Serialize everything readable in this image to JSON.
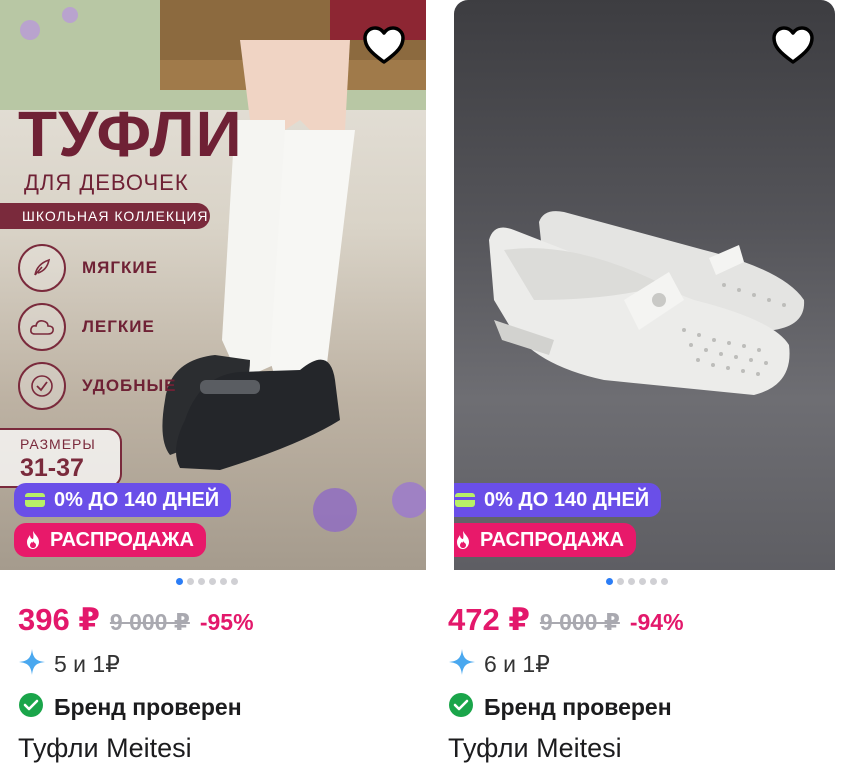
{
  "products": [
    {
      "promo": {
        "title": "ТУФЛИ",
        "subtitle": "ДЛЯ ДЕВОЧЕК",
        "ribbon": "ШКОЛЬНАЯ КОЛЛЕКЦИЯ",
        "features": [
          "МЯГКИЕ",
          "ЛЕГКИЕ",
          "УДОБНЫЕ"
        ],
        "sizes_label": "РАЗМЕРЫ",
        "sizes_value": "31-37"
      },
      "installment_badge": "0% ДО 140 ДНЕЙ",
      "sale_badge": "РАСПРОДАЖА",
      "price": "396 ₽",
      "old_price": "9 000 ₽",
      "discount": "-95%",
      "points": "5 и 1₽",
      "brand_check": "Бренд проверен",
      "title": "Туфли Meitesi",
      "carousel": {
        "total": 6,
        "active": 0
      }
    },
    {
      "installment_badge": "0% ДО 140 ДНЕЙ",
      "sale_badge": "РАСПРОДАЖА",
      "price": "472 ₽",
      "old_price": "9 000 ₽",
      "discount": "-94%",
      "points": "6 и 1₽",
      "brand_check": "Бренд проверен",
      "title": "Туфли Meitesi",
      "carousel": {
        "total": 6,
        "active": 0
      }
    }
  ],
  "colors": {
    "price": "#e3186b",
    "installment": "#6a4fe8",
    "sale": "#e8196a",
    "verified": "#1aa54a",
    "dot_active": "#2b7df6"
  },
  "icons": [
    "heart-icon",
    "card-icon",
    "fire-icon",
    "sparkle-icon",
    "check-badge-icon",
    "feather-icon",
    "cloud-icon",
    "check-circle-icon"
  ]
}
